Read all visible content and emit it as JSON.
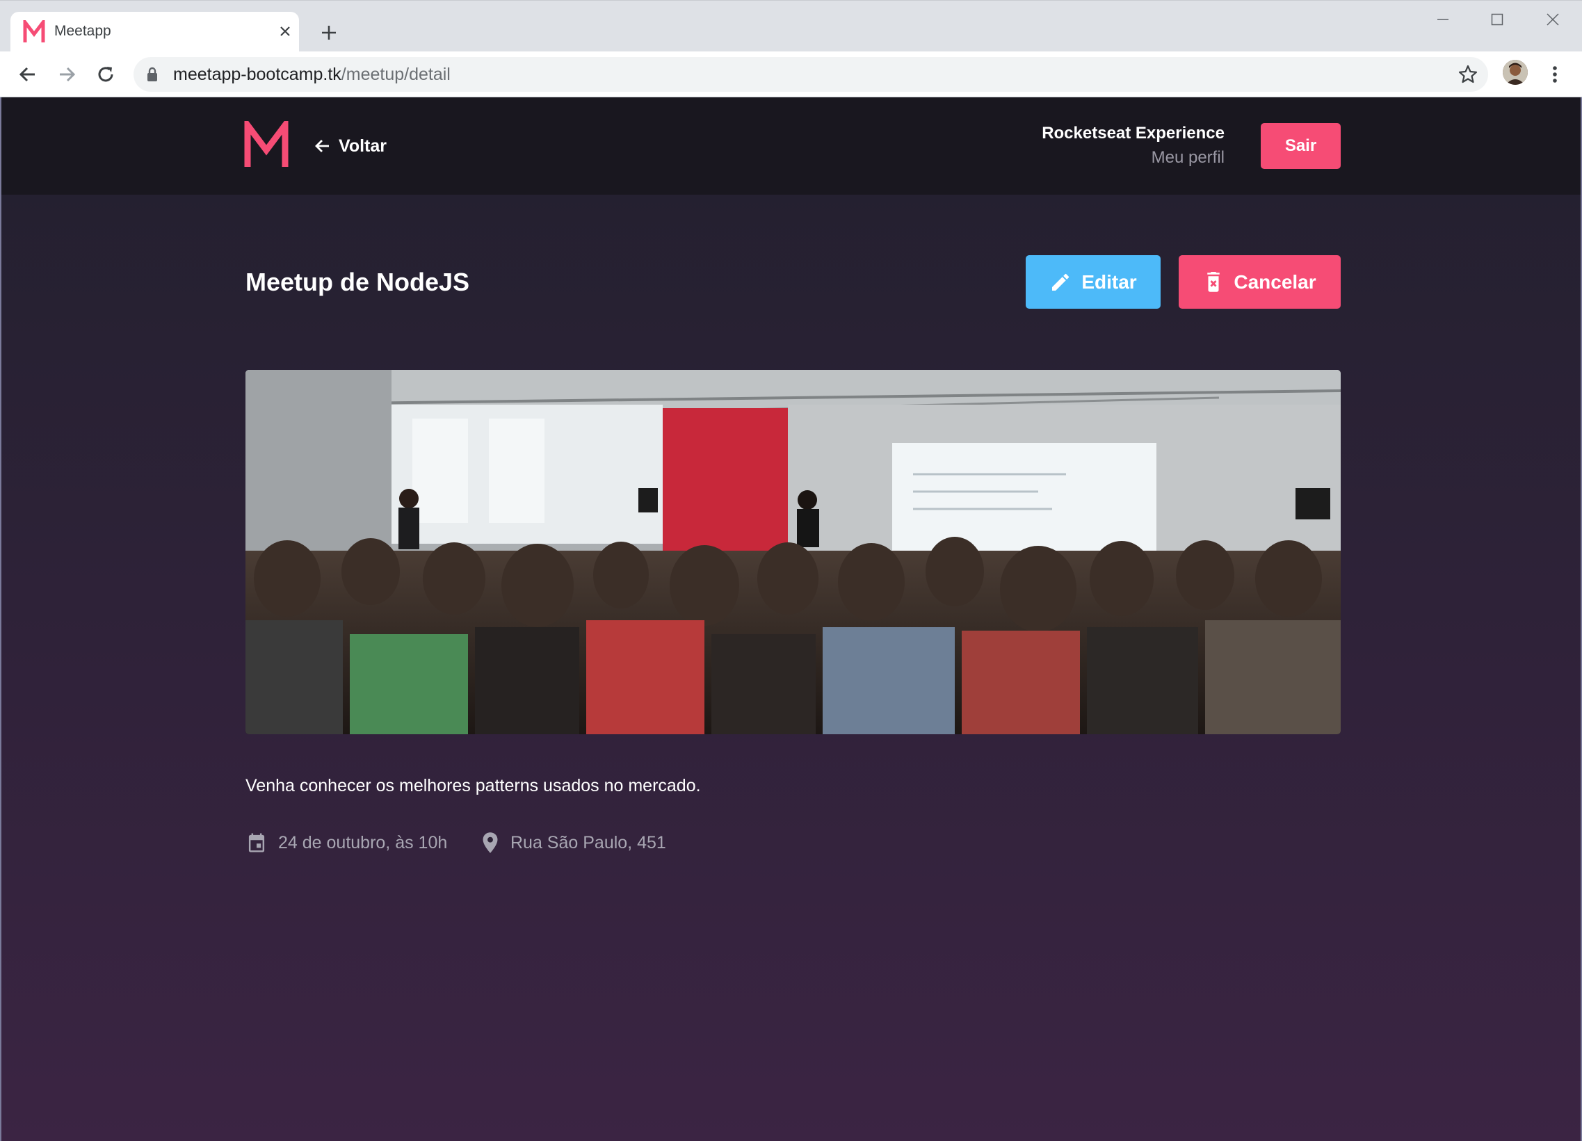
{
  "browser": {
    "tab_title": "Meetapp",
    "url_host": "meetapp-bootcamp.tk",
    "url_path": "/meetup/detail"
  },
  "header": {
    "back_label": "Voltar",
    "user_name": "Rocketseat Experience",
    "profile_link": "Meu perfil",
    "logout_label": "Sair"
  },
  "meetup": {
    "title": "Meetup de NodeJS",
    "edit_label": "Editar",
    "cancel_label": "Cancelar",
    "description": "Venha conhecer os melhores patterns usados no mercado.",
    "date": "24 de outubro, às 10h",
    "location": "Rua São Paulo, 451"
  },
  "colors": {
    "accent": "#f64c75",
    "edit_button": "#4dbaf9",
    "header_bg": "#19171f",
    "page_bg_top": "#22202e",
    "page_bg_bottom": "#3b2443"
  }
}
